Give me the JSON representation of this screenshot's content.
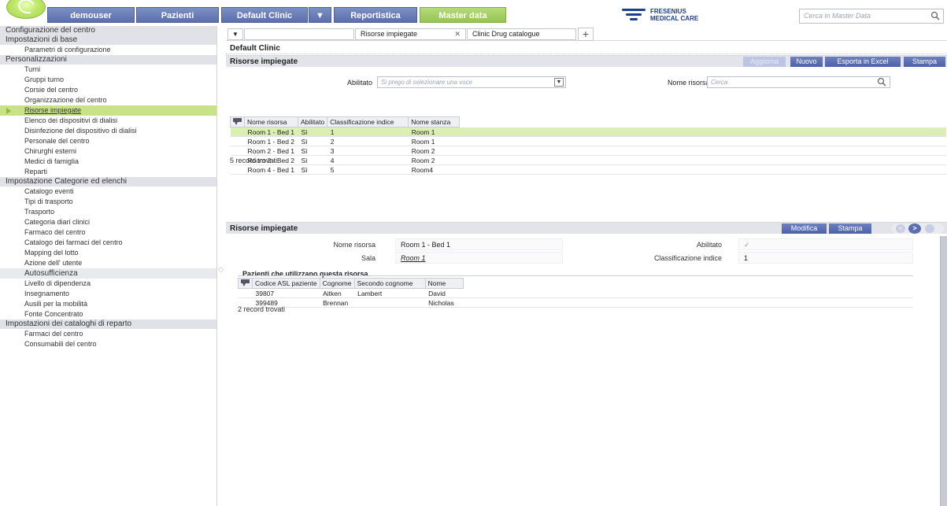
{
  "topbar": {
    "user": "demouser",
    "pazienti": "Pazienti",
    "clinic": "Default Clinic",
    "clinic_arrow": "▼",
    "reportistica": "Reportistica",
    "master_data": "Master data",
    "brand_line1": "FRESENIUS",
    "brand_line2": "MEDICAL CARE",
    "search_placeholder": "Cerca in Master Data"
  },
  "sidebar": {
    "items": [
      {
        "type": "section",
        "label": "Configurazione del centro"
      },
      {
        "type": "section",
        "label": "Impostazioni di base"
      },
      {
        "type": "item",
        "label": "Parametri di configurazione"
      },
      {
        "type": "section",
        "label": "Personalizzazioni"
      },
      {
        "type": "item",
        "label": "Turni"
      },
      {
        "type": "item",
        "label": "Gruppi turno"
      },
      {
        "type": "item",
        "label": "Corsie del centro"
      },
      {
        "type": "item",
        "label": "Organizzazione del centro"
      },
      {
        "type": "active",
        "label": "Risorse impiegate"
      },
      {
        "type": "item",
        "label": "Elenco dei dispositivi di dialisi"
      },
      {
        "type": "item",
        "label": "Disinfezione del dispositivo di dialisi"
      },
      {
        "type": "item",
        "label": "Personale del centro"
      },
      {
        "type": "item",
        "label": "Chirurghi esterni"
      },
      {
        "type": "item",
        "label": "Medici di famiglia"
      },
      {
        "type": "item",
        "label": "Reparti"
      },
      {
        "type": "section",
        "label": "Impostazione Categorie ed elenchi"
      },
      {
        "type": "item",
        "label": "Catalogo eventi"
      },
      {
        "type": "item",
        "label": "Tipi di trasporto"
      },
      {
        "type": "item",
        "label": "Trasporto"
      },
      {
        "type": "item",
        "label": "Categoria diari clinici"
      },
      {
        "type": "item",
        "label": "Farmaco del centro"
      },
      {
        "type": "item",
        "label": "Catalogo dei farmaci del centro"
      },
      {
        "type": "item",
        "label": "Mapping del lotto"
      },
      {
        "type": "item",
        "label": "Azione dell' utente"
      },
      {
        "type": "subsec",
        "label": "Autosufficienza"
      },
      {
        "type": "item",
        "label": "Livello di dipendenza"
      },
      {
        "type": "item",
        "label": "Insegnamento"
      },
      {
        "type": "item",
        "label": "Ausili per la mobilità"
      },
      {
        "type": "item",
        "label": "Fonte Concentrato"
      },
      {
        "type": "section",
        "label": "Impostazioni dei cataloghi di reparto"
      },
      {
        "type": "item",
        "label": "Farmaci del centro"
      },
      {
        "type": "item",
        "label": "Consumabili del centro"
      }
    ]
  },
  "tabs": {
    "dropdown": "▼",
    "tab1": "Risorse impiegate",
    "tab1_close": "✕",
    "tab2": "Clinic Drug catalogue",
    "add": "+"
  },
  "clinic_title": "Default Clinic",
  "list_panel": {
    "title": "Risorse impiegate",
    "buttons": {
      "aggiorna": "Aggiorna",
      "nuovo": "Nuovo",
      "esporta": "Esporta in Excel",
      "stampa": "Stampa"
    },
    "filter_abilitato_label": "Abilitato",
    "filter_abilitato_placeholder": "Si prego di selezionare una voce",
    "filter_nome_label": "Nome risorsa",
    "filter_nome_placeholder": "Cerca",
    "columns": [
      "Nome risorsa",
      "Abilitato",
      "Classificazione indice",
      "Nome stanza"
    ],
    "rows": [
      [
        "Room 1 - Bed 1",
        "Sì",
        "1",
        "Room 1"
      ],
      [
        "Room 1 - Bed 2",
        "Sì",
        "2",
        "Room 1"
      ],
      [
        "Room 2 - Bed 1",
        "Sì",
        "3",
        "Room 2"
      ],
      [
        "Room 2 - Bed 2",
        "Sì",
        "4",
        "Room 2"
      ],
      [
        "Room 4 - Bed 1",
        "Sì",
        "5",
        "Room4"
      ]
    ],
    "record_count": "5 record trovati"
  },
  "detail_panel": {
    "title": "Risorse impiegate",
    "buttons": {
      "modifica": "Modifica",
      "stampa": "Stampa"
    },
    "nome_risorsa_label": "Nome risorsa",
    "nome_risorsa_value": "Room 1 - Bed 1",
    "sala_label": "Sala",
    "sala_value": "Room 1",
    "abilitato_label": "Abilitato",
    "abilitato_value": "✓",
    "classificazione_label": "Classificazione indice",
    "classificazione_value": "1",
    "patients_title": "Pazienti che utilizzano questa risorsa",
    "patient_columns": [
      "Codice ASL paziente",
      "Cognome",
      "Secondo cognome",
      "Nome"
    ],
    "patient_rows": [
      [
        "39807",
        "Aitken",
        "Lambert",
        "David"
      ],
      [
        "399489",
        "Brennan",
        "",
        "Nicholas"
      ]
    ],
    "patient_count": "2 record trovati"
  }
}
